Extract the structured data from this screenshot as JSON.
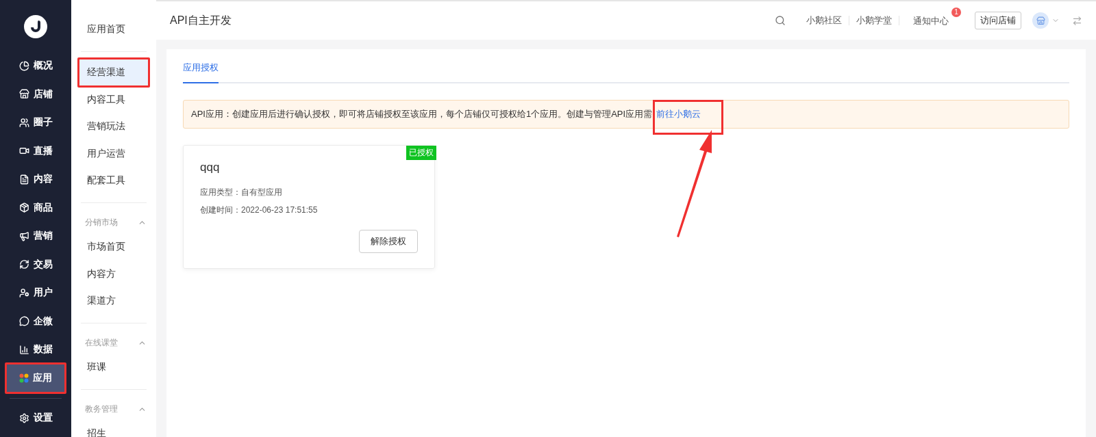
{
  "nav": [
    {
      "label": "概况",
      "selected": false,
      "highlighted": false
    },
    {
      "label": "店铺",
      "selected": false,
      "highlighted": false
    },
    {
      "label": "圈子",
      "selected": false,
      "highlighted": false
    },
    {
      "label": "直播",
      "selected": false,
      "highlighted": false
    },
    {
      "label": "内容",
      "selected": false,
      "highlighted": false
    },
    {
      "label": "商品",
      "selected": false,
      "highlighted": false
    },
    {
      "label": "营销",
      "selected": false,
      "highlighted": false
    },
    {
      "label": "交易",
      "selected": false,
      "highlighted": false
    },
    {
      "label": "用户",
      "selected": false,
      "highlighted": false
    },
    {
      "label": "企微",
      "selected": false,
      "highlighted": false
    },
    {
      "label": "数据",
      "selected": false,
      "highlighted": false
    },
    {
      "label": "应用",
      "selected": true,
      "highlighted": true
    }
  ],
  "nav_bottom": {
    "label": "设置"
  },
  "submenu": {
    "home": {
      "label": "应用首页"
    },
    "items": [
      {
        "label": "经营渠道",
        "selected": true,
        "highlighted": true
      },
      {
        "label": "内容工具",
        "selected": false,
        "highlighted": false
      },
      {
        "label": "营销玩法",
        "selected": false,
        "highlighted": false
      },
      {
        "label": "用户运营",
        "selected": false,
        "highlighted": false
      },
      {
        "label": "配套工具",
        "selected": false,
        "highlighted": false
      }
    ],
    "groups": [
      {
        "title": "分销市场",
        "expanded": true,
        "children": [
          {
            "label": "市场首页"
          },
          {
            "label": "内容方"
          },
          {
            "label": "渠道方"
          }
        ]
      },
      {
        "title": "在线课堂",
        "expanded": true,
        "children": [
          {
            "label": "班课"
          }
        ]
      },
      {
        "title": "教务管理",
        "expanded": true,
        "children": [
          {
            "label": "招生"
          }
        ]
      }
    ]
  },
  "header": {
    "title": "API自主开发",
    "links": [
      "小鹅社区",
      "小鹅学堂"
    ],
    "notice": {
      "label": "通知中心",
      "badge": "1"
    },
    "visit_button": "访问店铺"
  },
  "tabs": [
    {
      "label": "应用授权",
      "selected": true
    }
  ],
  "notice": {
    "text": "API应用：创建应用后进行确认授权，即可将店铺授权至该应用，每个店铺仅可授权给1个应用。创建与管理API应用需",
    "link": "前往小鹅云",
    "highlighted": true
  },
  "apps": [
    {
      "name": "qqq",
      "tag": "已授权",
      "fields": [
        {
          "label": "应用类型：",
          "value": "自有型应用"
        },
        {
          "label": "创建时间：",
          "value": "2022-06-23 17:51:55"
        }
      ],
      "action": "解除授权"
    }
  ]
}
